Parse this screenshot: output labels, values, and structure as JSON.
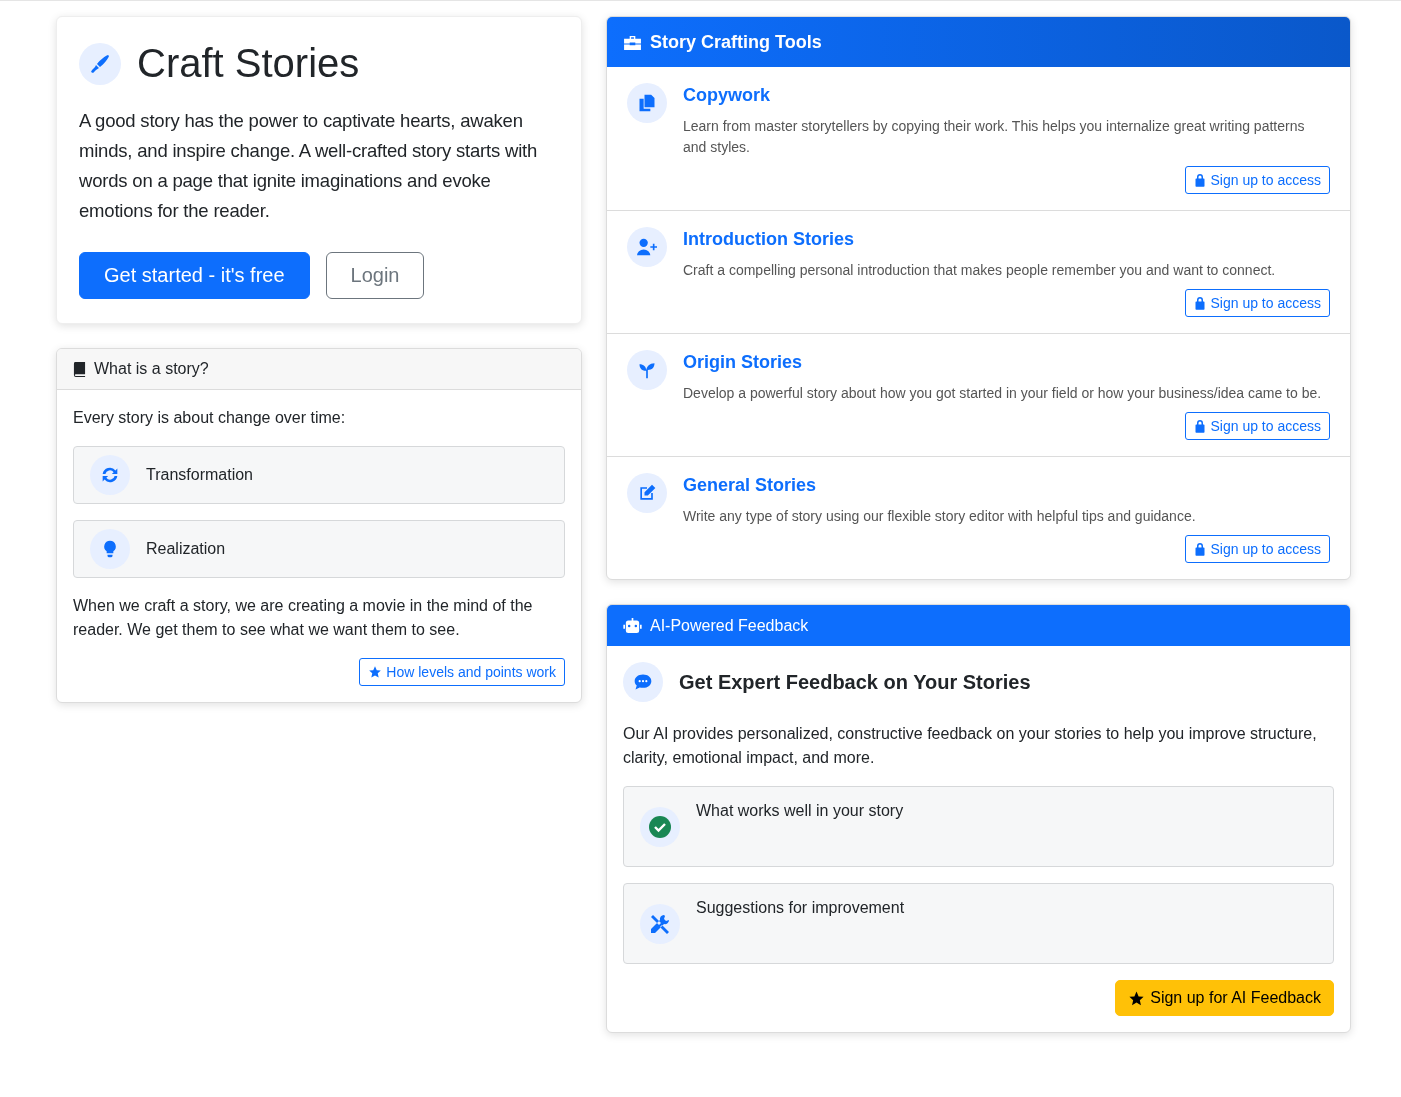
{
  "hero": {
    "title": "Craft Stories",
    "text": "A good story has the power to captivate hearts, awaken minds, and inspire change. A well-crafted story starts with words on a page that ignite imaginations and evoke emotions for the reader.",
    "buttons": [
      {
        "label": "Get started - it's free",
        "kind": "primary"
      },
      {
        "label": "Login",
        "kind": "outline"
      }
    ]
  },
  "story_card": {
    "header": "What is a story?",
    "intro": "Every story is about change over time:",
    "items": [
      {
        "label": "Transformation"
      },
      {
        "label": "Realization"
      }
    ],
    "text": "When we craft a story, we are creating a movie in the mind of the reader. We get them to see what we want them to see.",
    "link": "How levels and points work"
  },
  "tools": {
    "header": "Story Crafting Tools",
    "items": [
      {
        "title": "Copywork",
        "text": "Learn from master storytellers by copying their work. This helps you internalize great writing patterns and styles.",
        "button": "Sign up to access"
      },
      {
        "title": "Introduction Stories",
        "text": "Craft a compelling personal introduction that makes people remember you and want to connect.",
        "button": "Sign up to access"
      },
      {
        "title": "Origin Stories",
        "text": "Develop a powerful story about how you got started in your field or how your business/idea came to be.",
        "button": "Sign up to access"
      },
      {
        "title": "General Stories",
        "text": "Write any type of story using our flexible story editor with helpful tips and guidance.",
        "button": "Sign up to access"
      }
    ]
  },
  "feedback": {
    "header": "AI-Powered Feedback",
    "heading": "Get Expert Feedback on Your Stories",
    "text": "Our AI provides personalized, constructive feedback on your stories to help you improve structure, clarity, emotional impact, and more.",
    "items": [
      {
        "label": "What works well in your story"
      },
      {
        "label": "Suggestions for improvement"
      }
    ],
    "button": "Sign up for AI Feedback"
  }
}
